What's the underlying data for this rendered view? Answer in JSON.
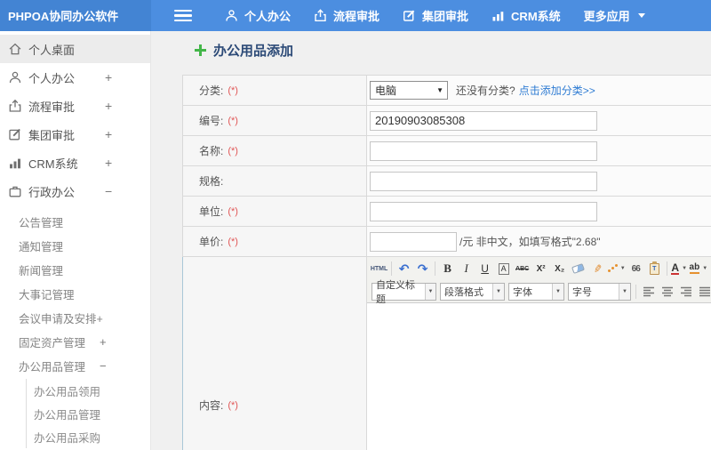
{
  "header": {
    "brand": "PHPOA协同办公软件",
    "nav": [
      {
        "label": "个人办公"
      },
      {
        "label": "流程审批"
      },
      {
        "label": "集团审批"
      },
      {
        "label": "CRM系统"
      },
      {
        "label": "更多应用"
      }
    ]
  },
  "sidebar": {
    "items": [
      {
        "label": "个人桌面",
        "expand": ""
      },
      {
        "label": "个人办公",
        "expand": "+"
      },
      {
        "label": "流程审批",
        "expand": "+"
      },
      {
        "label": "集团审批",
        "expand": "+"
      },
      {
        "label": "CRM系统",
        "expand": "+"
      },
      {
        "label": "行政办公",
        "expand": "−"
      }
    ],
    "sub_items": [
      {
        "label": "公告管理",
        "expand": ""
      },
      {
        "label": "通知管理",
        "expand": ""
      },
      {
        "label": "新闻管理",
        "expand": ""
      },
      {
        "label": "大事记管理",
        "expand": ""
      },
      {
        "label": "会议申请及安排+",
        "expand": ""
      },
      {
        "label": "固定资产管理",
        "expand": "+"
      },
      {
        "label": "办公用品管理",
        "expand": "−"
      }
    ],
    "leaf_items": [
      {
        "label": "办公用品领用"
      },
      {
        "label": "办公用品管理"
      },
      {
        "label": "办公用品采购"
      }
    ]
  },
  "main": {
    "title": "办公用品添加",
    "form": {
      "category": {
        "label": "分类:",
        "required": "(*)",
        "value": "电脑",
        "hint": "还没有分类?",
        "link": "点击添加分类>>"
      },
      "code": {
        "label": "编号:",
        "required": "(*)",
        "value": "20190903085308"
      },
      "name": {
        "label": "名称:",
        "required": "(*)",
        "value": ""
      },
      "spec": {
        "label": "规格:",
        "required": "",
        "value": ""
      },
      "unit": {
        "label": "单位:",
        "required": "(*)",
        "value": ""
      },
      "price": {
        "label": "单价:",
        "required": "(*)",
        "value": "",
        "suffix": "/元 非中文，如填写格式\"2.68\""
      },
      "content": {
        "label": "内容:",
        "required": "(*)"
      }
    },
    "editor": {
      "source": "HTML",
      "undo": "↶",
      "redo": "↷",
      "bold": "B",
      "italic": "I",
      "underline": "U",
      "box_a": "A",
      "strike": "ABC",
      "superscript": "X²",
      "subscript": "X₂",
      "quote": "66",
      "font_color": "A",
      "highlight": "ab",
      "link": "∞",
      "dropdowns": [
        {
          "label": "自定义标题"
        },
        {
          "label": "段落格式"
        },
        {
          "label": "字体"
        },
        {
          "label": "字号"
        }
      ]
    }
  },
  "colors": {
    "header_blue": "#4c8ee0",
    "brand_blue": "#4384d3",
    "accent_green": "#43b649",
    "link_blue": "#2f7cd3",
    "required_red": "#e05555",
    "title_navy": "#2c4a77"
  }
}
